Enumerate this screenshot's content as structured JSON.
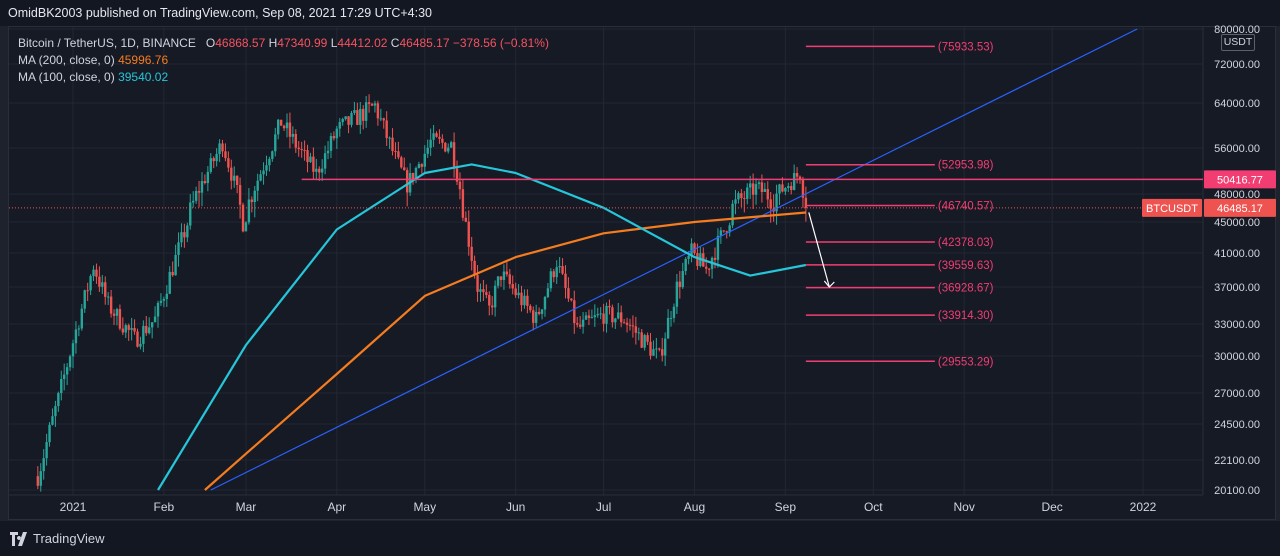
{
  "header": {
    "text": "OmidBK2003 published on TradingView.com, Sep 08, 2021 17:29 UTC+4:30"
  },
  "legend": {
    "symbol": "Bitcoin / TetherUS, 1D, BINANCE",
    "ohlc": {
      "o_label": "O",
      "o": "46868.57",
      "h_label": "H",
      "h": "47340.99",
      "l_label": "L",
      "l": "44412.02",
      "c_label": "C",
      "c": "46485.17",
      "change": "−378.56 (−0.81%)"
    },
    "ma200": {
      "label": "MA (200, close, 0)",
      "value": "45996.76",
      "color": "#f57c1f"
    },
    "ma100": {
      "label": "MA (100, close, 0)",
      "value": "39540.02",
      "color": "#26c6da"
    }
  },
  "footer": {
    "brand": "TradingView"
  },
  "colors": {
    "up": "#26a69a",
    "down": "#ef5350",
    "level": "#f23d72",
    "trend": "#2962ff",
    "bg": "#161a25",
    "grid": "#232733"
  },
  "chart_data": {
    "type": "candlestick",
    "ylim": [
      20000,
      80000
    ],
    "yscale": "log",
    "currency": "USDT",
    "y_ticks": [
      "80000.00",
      "72000.00",
      "64000.00",
      "56000.00",
      "50416.77",
      "48000.00",
      "45000.00",
      "41000.00",
      "37000.00",
      "33000.00",
      "30000.00",
      "27000.00",
      "24500.00",
      "22100.00",
      "20100.00"
    ],
    "x_ticks": [
      {
        "label": "2021",
        "date": "2021-01-01"
      },
      {
        "label": "Feb",
        "date": "2021-02-01"
      },
      {
        "label": "Mar",
        "date": "2021-03-01"
      },
      {
        "label": "Apr",
        "date": "2021-04-01"
      },
      {
        "label": "May",
        "date": "2021-05-01"
      },
      {
        "label": "Jun",
        "date": "2021-06-01"
      },
      {
        "label": "Jul",
        "date": "2021-07-01"
      },
      {
        "label": "Aug",
        "date": "2021-08-01"
      },
      {
        "label": "Sep",
        "date": "2021-09-01"
      },
      {
        "label": "Oct",
        "date": "2021-10-01"
      },
      {
        "label": "Nov",
        "date": "2021-11-01"
      },
      {
        "label": "Dec",
        "date": "2021-12-01"
      },
      {
        "label": "2022",
        "date": "2022-01-01"
      }
    ],
    "price_anchors": [
      {
        "date": "2020-12-20",
        "price": 21000
      },
      {
        "date": "2021-01-08",
        "price": 39500
      },
      {
        "date": "2021-01-13",
        "price": 35000
      },
      {
        "date": "2021-01-22",
        "price": 31500
      },
      {
        "date": "2021-01-29",
        "price": 33500
      },
      {
        "date": "2021-02-10",
        "price": 46000
      },
      {
        "date": "2021-02-21",
        "price": 57000
      },
      {
        "date": "2021-02-28",
        "price": 45000
      },
      {
        "date": "2021-03-13",
        "price": 60500
      },
      {
        "date": "2021-03-25",
        "price": 51500
      },
      {
        "date": "2021-04-01",
        "price": 59000
      },
      {
        "date": "2021-04-14",
        "price": 63500
      },
      {
        "date": "2021-04-25",
        "price": 49500
      },
      {
        "date": "2021-05-03",
        "price": 57000
      },
      {
        "date": "2021-05-10",
        "price": 56500
      },
      {
        "date": "2021-05-19",
        "price": 37000
      },
      {
        "date": "2021-05-23",
        "price": 34500
      },
      {
        "date": "2021-05-27",
        "price": 38500
      },
      {
        "date": "2021-06-08",
        "price": 33500
      },
      {
        "date": "2021-06-15",
        "price": 40000
      },
      {
        "date": "2021-06-22",
        "price": 32500
      },
      {
        "date": "2021-07-01",
        "price": 34000
      },
      {
        "date": "2021-07-08",
        "price": 33500
      },
      {
        "date": "2021-07-20",
        "price": 29800
      },
      {
        "date": "2021-07-26",
        "price": 37000
      },
      {
        "date": "2021-07-31",
        "price": 41000
      },
      {
        "date": "2021-08-05",
        "price": 39000
      },
      {
        "date": "2021-08-14",
        "price": 46500
      },
      {
        "date": "2021-08-22",
        "price": 49000
      },
      {
        "date": "2021-08-28",
        "price": 47500
      },
      {
        "date": "2021-09-06",
        "price": 51500
      },
      {
        "date": "2021-09-08",
        "price": 46485
      }
    ],
    "series": [
      {
        "name": "MA (200, close, 0)",
        "color": "#f57c1f",
        "points": [
          {
            "date": "2021-02-15",
            "price": 20100
          },
          {
            "date": "2021-03-01",
            "price": 22500
          },
          {
            "date": "2021-04-01",
            "price": 28500
          },
          {
            "date": "2021-05-01",
            "price": 36000
          },
          {
            "date": "2021-06-01",
            "price": 40500
          },
          {
            "date": "2021-07-01",
            "price": 43500
          },
          {
            "date": "2021-08-01",
            "price": 45000
          },
          {
            "date": "2021-09-08",
            "price": 45997
          }
        ]
      },
      {
        "name": "MA (100, close, 0)",
        "color": "#26c6da",
        "points": [
          {
            "date": "2021-01-30",
            "price": 20100
          },
          {
            "date": "2021-03-01",
            "price": 31000
          },
          {
            "date": "2021-04-01",
            "price": 44000
          },
          {
            "date": "2021-05-01",
            "price": 51500
          },
          {
            "date": "2021-05-17",
            "price": 53000
          },
          {
            "date": "2021-06-01",
            "price": 51500
          },
          {
            "date": "2021-07-01",
            "price": 46500
          },
          {
            "date": "2021-08-01",
            "price": 40500
          },
          {
            "date": "2021-08-20",
            "price": 38300
          },
          {
            "date": "2021-09-08",
            "price": 39540
          }
        ]
      }
    ],
    "trendline": {
      "from": {
        "date": "2021-02-17",
        "price": 20100
      },
      "to": {
        "date": "2021-12-30",
        "price": 80000
      }
    },
    "resistance_line": {
      "price": 50416.77,
      "from_date": "2021-03-20",
      "label": "50416.77"
    },
    "levels": [
      {
        "price": 75933.53,
        "label": "(75933.53)"
      },
      {
        "price": 52953.98,
        "label": "(52953.98)"
      },
      {
        "price": 46740.57,
        "label": "(46740.57)"
      },
      {
        "price": 42378.03,
        "label": "(42378.03)"
      },
      {
        "price": 39559.63,
        "label": "(39559.63)"
      },
      {
        "price": 36928.67,
        "label": "(36928.67)"
      },
      {
        "price": 33914.3,
        "label": "(33914.30)"
      },
      {
        "price": 29553.29,
        "label": "(29553.29)"
      }
    ],
    "levels_from_date": "2021-09-08",
    "levels_to_date": "2021-10-22",
    "last_price": {
      "label": "BTCUSDT",
      "value": "46485.17",
      "price": 46485.17
    },
    "arrow": {
      "from": {
        "date": "2021-09-09",
        "price": 46000
      },
      "to": {
        "date": "2021-09-16",
        "price": 37000
      }
    }
  }
}
